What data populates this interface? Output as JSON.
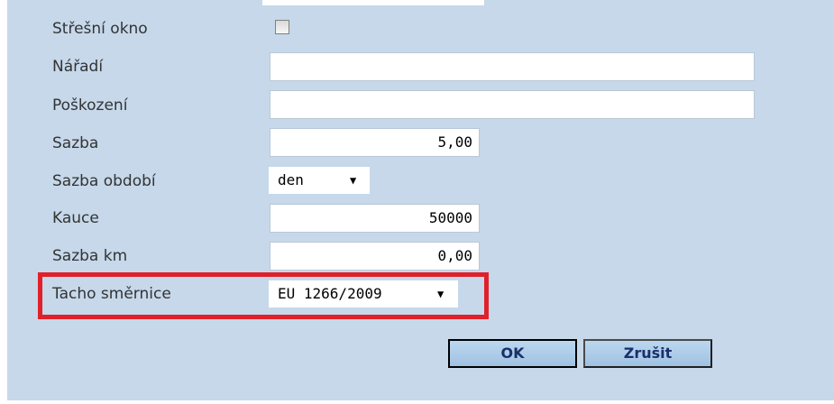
{
  "form": {
    "rows": {
      "stresni_okno": {
        "label": "Střešní okno",
        "checked": false
      },
      "naradi": {
        "label": "Nářadí",
        "value": ""
      },
      "poskozeni": {
        "label": "Poškození",
        "value": ""
      },
      "sazba": {
        "label": "Sazba",
        "value": "5,00"
      },
      "sazba_obdobi": {
        "label": "Sazba období",
        "value": "den"
      },
      "kauce": {
        "label": "Kauce",
        "value": "50000"
      },
      "sazba_km": {
        "label": "Sazba km",
        "value": "0,00"
      },
      "tacho_smernice": {
        "label": "Tacho směrnice",
        "value": "EU 1266/2009"
      }
    }
  },
  "buttons": {
    "ok_label": "OK",
    "cancel_label": "Zrušit"
  },
  "highlight_color": "#e0202a",
  "panel_color": "#c6d8ea"
}
